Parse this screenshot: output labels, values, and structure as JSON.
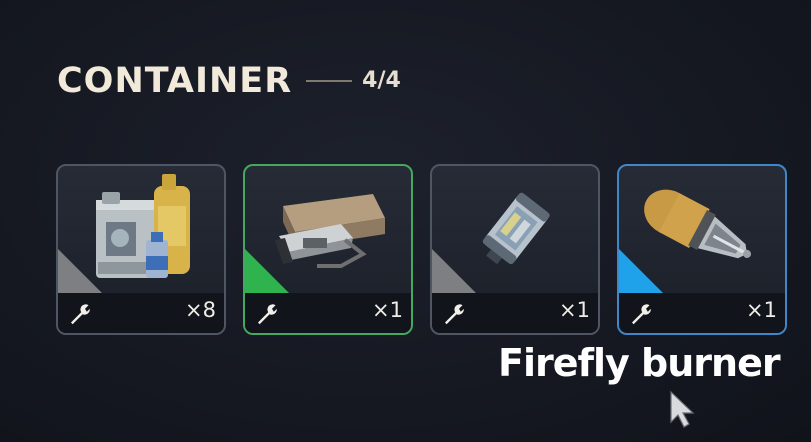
{
  "container": {
    "title": "CONTAINER",
    "count": "4/4"
  },
  "slots": [
    {
      "item_icon": "fuel-cans-icon",
      "quantity": "×8",
      "rarity_color": "#7d7f83",
      "border_color": "#4f5663",
      "action_icon": "wrench-icon"
    },
    {
      "item_icon": "flare-box-icon",
      "quantity": "×1",
      "rarity_color": "#2fb34f",
      "border_color": "#45a860",
      "action_icon": "wrench-icon"
    },
    {
      "item_icon": "canister-icon",
      "quantity": "×1",
      "rarity_color": "#7d7f83",
      "border_color": "#4f5663",
      "action_icon": "wrench-icon"
    },
    {
      "item_icon": "firefly-burner-icon",
      "quantity": "×1",
      "rarity_color": "#1fa2ea",
      "border_color": "#3f87c9",
      "action_icon": "wrench-icon"
    }
  ],
  "hover_label": "Firefly burner",
  "cursor_icon": "arrow-cursor-icon"
}
